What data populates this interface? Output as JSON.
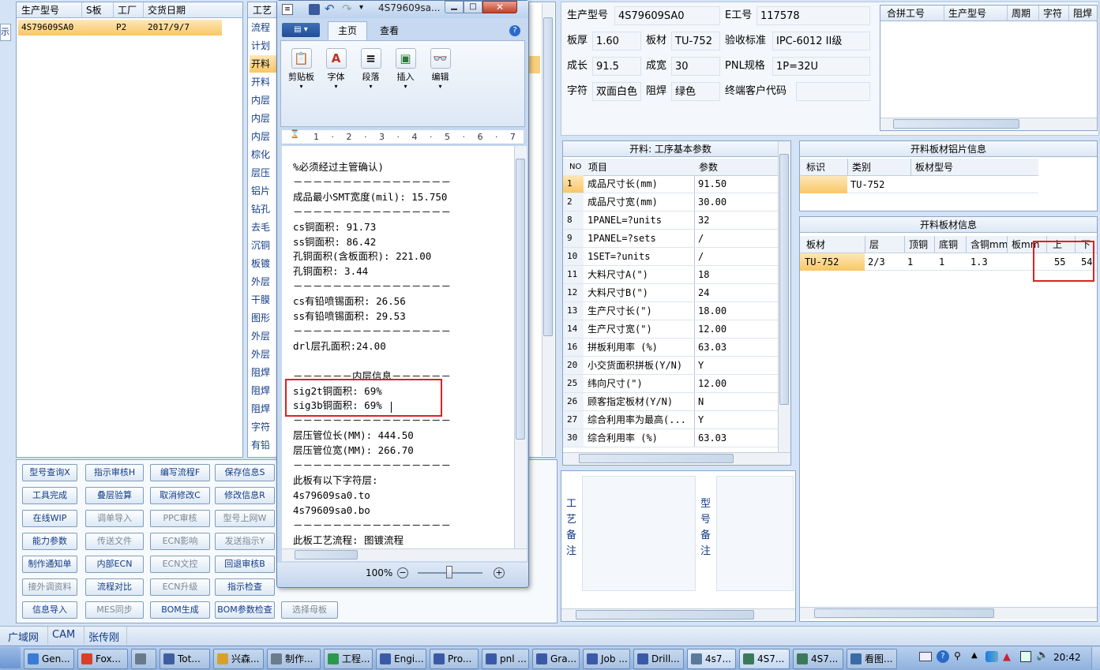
{
  "left_list": {
    "headers": [
      "生产型号",
      "S板",
      "工厂",
      "交货日期"
    ],
    "row": [
      "4S79609SA0",
      "",
      "P2",
      "2017/9/7"
    ],
    "side_tab": "示"
  },
  "process_list": {
    "header": "工艺",
    "items": [
      "流程",
      "计划",
      "开料",
      "开料",
      "内层",
      "内层",
      "内层",
      "棕化",
      "层压",
      "铝片",
      "钻孔",
      "去毛",
      "沉铜",
      "板镀",
      "外层",
      "干膜",
      "图形",
      "外层",
      "外层",
      "阻焊",
      "阻焊",
      "阻焊",
      "字符",
      "有铅"
    ]
  },
  "buttons": [
    [
      "型号查询X",
      "指示审核H",
      "编写流程F",
      "保存信息S"
    ],
    [
      "工具完成",
      "叠层验算",
      "取消修改C",
      "修改信息R"
    ],
    [
      "在线WIP",
      "调单导入",
      "PPC审核",
      "型号上网W"
    ],
    [
      "能力参数",
      "传送文件",
      "ECN影响",
      "发送指示Y"
    ],
    [
      "制作通知单",
      "内部ECN",
      "ECN文控",
      "回退审核B"
    ],
    [
      "接外调资料",
      "流程对比",
      "ECN升级",
      "指示检查"
    ],
    [
      "信息导入",
      "MES同步",
      "BOM生成",
      "BOM参数检查",
      "选择母板"
    ]
  ],
  "disabled_buttons": [
    "调单导入",
    "PPC审核",
    "型号上网W",
    "传送文件",
    "ECN影响",
    "发送指示Y",
    "ECN文控",
    "接外调资料",
    "ECN升级",
    "MES同步",
    "选择母板"
  ],
  "status_bar": [
    "广域网",
    "CAM",
    "张传刚"
  ],
  "wordpad": {
    "title": "4S79609sa...",
    "tabs": [
      "主页",
      "查看"
    ],
    "ribbon": [
      "剪贴板",
      "字体",
      "段落",
      "插入",
      "编辑"
    ],
    "ruler": "1 · 2 · 3 · 4 · 5 · 6 · 7",
    "zoom": "100%",
    "lines": [
      "%必须经过主管确认)",
      "－－－－－－－－－－－－－－－－",
      "成品最小SMT宽度(mil): 15.750",
      "－－－－－－－－－－－－－－－－",
      "cs铜面积: 91.73",
      "ss铜面积: 86.42",
      "孔铜面积(含板面积): 221.00",
      "孔铜面积: 3.44",
      "－－－－－－－－－－－－－－－－",
      "cs有铅喷锡面积: 26.56",
      "ss有铅喷锡面积: 29.53",
      "－－－－－－－－－－－－－－－－",
      "drl层孔面积:24.00",
      "",
      "－－－－－－内层信息－－－－－－",
      "sig2t铜面积: 69%",
      "sig3b铜面积: 69%",
      "－－－－－－－－－－－－－－－－",
      "层压管位长(MM): 444.50",
      "层压管位宽(MM): 266.70",
      "－－－－－－－－－－－－－－－－",
      "此板有以下字符层:",
      "4s79609sa0.to",
      "4s79609sa0.bo",
      "－－－－－－－－－－－－－－－－",
      "此板工艺流程: 图镀流程"
    ]
  },
  "info": {
    "prod_model_label": "生产型号",
    "prod_model": "4S79609SA0",
    "eno_label": "E工号",
    "eno": "117578",
    "thick_label": "板厚",
    "thick": "1.60",
    "material_label": "板材",
    "material": "TU-752",
    "std_label": "验收标准",
    "std": "IPC-6012 II级",
    "len_label": "成长",
    "len": "91.5",
    "wid_label": "成宽",
    "wid": "30",
    "pnl_label": "PNL规格",
    "pnl": "1P=32U",
    "char_label": "字符",
    "char": "双面白色",
    "mask_label": "阻焊",
    "mask": "绿色",
    "cust_label": "终端客户代码",
    "cust": ""
  },
  "combine_headers": [
    "合拼工号",
    "生产型号",
    "周期",
    "字符",
    "阻焊"
  ],
  "params": {
    "title": "开料: 工序基本参数",
    "headers": [
      "NO",
      "项目",
      "参数"
    ],
    "rows": [
      [
        "1",
        "成品尺寸长(mm)",
        "91.50"
      ],
      [
        "2",
        "成品尺寸宽(mm)",
        "30.00"
      ],
      [
        "8",
        "1PANEL=?units",
        "32"
      ],
      [
        "9",
        "1PANEL=?sets",
        "/"
      ],
      [
        "10",
        "1SET=?units",
        "/"
      ],
      [
        "11",
        "大料尺寸A(\")",
        "18"
      ],
      [
        "12",
        "大料尺寸B(\")",
        "24"
      ],
      [
        "13",
        "生产尺寸长(\")",
        "18.00"
      ],
      [
        "14",
        "生产尺寸宽(\")",
        "12.00"
      ],
      [
        "16",
        "拼板利用率 (%)",
        "63.03"
      ],
      [
        "20",
        "小交货面积拼板(Y/N)",
        "Y"
      ],
      [
        "25",
        "纬向尺寸(\")",
        "12.00"
      ],
      [
        "26",
        "顾客指定板材(Y/N)",
        "N"
      ],
      [
        "27",
        "综合利用率为最高(...",
        "Y"
      ],
      [
        "30",
        "综合利用率 (%)",
        "63.03"
      ]
    ]
  },
  "al_sheet": {
    "title": "开料板材铝片信息",
    "headers": [
      "标识",
      "类别",
      "板材型号"
    ],
    "row": [
      "",
      "TU-752",
      ""
    ]
  },
  "sheet_info": {
    "title": "开料板材信息",
    "headers": [
      "板材",
      "层",
      "顶铜",
      "底铜",
      "含铜mm",
      "板mm",
      "上",
      "下"
    ],
    "row": [
      "TU-752",
      "2/3",
      "1",
      "1",
      "1.3",
      "",
      "55",
      "54"
    ]
  },
  "remarks": {
    "process": "工艺备注",
    "model": "型号备注"
  },
  "taskbar": {
    "items": [
      "Gen...",
      "Fox...",
      "",
      "Tot...",
      "兴森...",
      "制作...",
      "工程...",
      "Engi...",
      "Pro...",
      "pnl ...",
      "Gra...",
      "Job ...",
      "Drill...",
      "4s7...",
      "4S7...",
      "4S7...",
      "看图..."
    ],
    "clock": "20:42"
  }
}
